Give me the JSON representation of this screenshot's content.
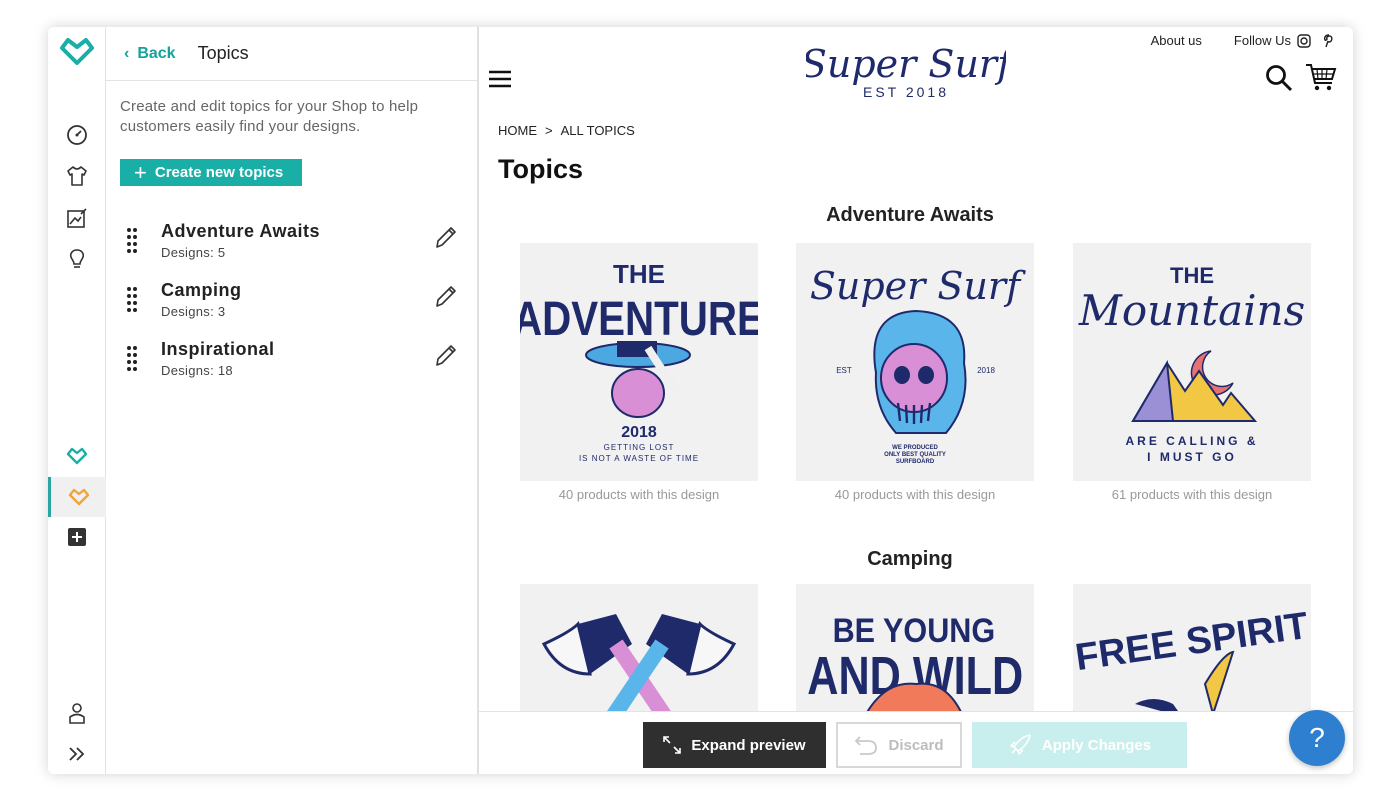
{
  "colors": {
    "accent": "#19aea6",
    "brand_navy": "#1f2a6b",
    "help_blue": "#2f7fd0",
    "rail_orange": "#f0a43c"
  },
  "rail": {
    "icons": [
      "logo-icon",
      "dashboard-icon",
      "tshirt-icon",
      "image-edit-icon",
      "lightbulb-icon",
      "heart-teal-icon",
      "heart-orange-icon",
      "add-square-icon",
      "user-icon",
      "expand-chevrons-icon"
    ]
  },
  "panel": {
    "back_label": "Back",
    "title": "Topics",
    "description": "Create and edit topics for your Shop to help customers easily find your designs.",
    "create_button": "Create new topics",
    "topics": [
      {
        "name": "Adventure Awaits",
        "count": "Designs: 5"
      },
      {
        "name": "Camping",
        "count": "Designs: 3"
      },
      {
        "name": "Inspirational",
        "count": "Designs: 18"
      }
    ]
  },
  "preview": {
    "logo_title": "Super Surf",
    "logo_sub": "EST 2018",
    "about_link": "About us",
    "follow_label": "Follow Us",
    "breadcrumb": [
      "HOME",
      ">",
      "ALL TOPICS"
    ],
    "page_title": "Topics",
    "sections": [
      {
        "title": "Adventure Awaits",
        "cards": [
          {
            "caption": "40 products with this design",
            "art": {
              "l1": "THE",
              "l2": "ADVENTURE",
              "year": "2018",
              "tag1": "GETTING LOST",
              "tag2": "IS NOT A WASTE OF TIME"
            }
          },
          {
            "caption": "40 products with this design",
            "art": {
              "title": "Super Surf",
              "left": "EST",
              "right": "2018",
              "tag1": "WE PRODUCED",
              "tag2": "ONLY BEST QUALITY",
              "tag3": "SURFBOARD"
            }
          },
          {
            "caption": "61 products with this design",
            "art": {
              "l1": "THE",
              "l2": "Mountains",
              "tag1": "ARE CALLING &",
              "tag2": "I MUST GO"
            }
          }
        ]
      },
      {
        "title": "Camping",
        "cards": [
          {
            "art": {}
          },
          {
            "art": {
              "l1": "BE YOUNG",
              "l2": "AND WILD"
            }
          },
          {
            "art": {
              "l1": "FREE SPIRIT"
            }
          }
        ]
      }
    ],
    "buttons": {
      "expand": "Expand preview",
      "discard": "Discard",
      "apply": "Apply Changes"
    },
    "help": "?"
  }
}
